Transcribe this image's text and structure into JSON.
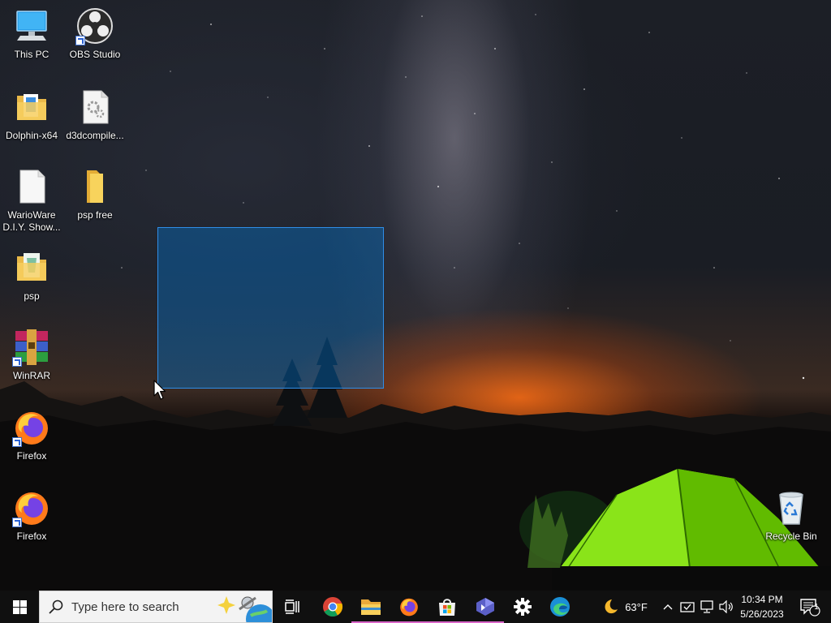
{
  "desktop": {
    "icons": [
      {
        "label": "This PC",
        "icon": "computer-icon"
      },
      {
        "label": "OBS Studio",
        "icon": "obs-studio-icon"
      },
      {
        "label": "Dolphin-x64",
        "icon": "folder-icon"
      },
      {
        "label": "d3dcompile...",
        "icon": "dll-file-icon"
      },
      {
        "label": "WarioWare D.I.Y. Show...",
        "icon": "blank-file-icon"
      },
      {
        "label": "psp free",
        "icon": "folder-icon"
      },
      {
        "label": "psp",
        "icon": "folder-icon"
      },
      {
        "label": "WinRAR",
        "icon": "winrar-icon"
      },
      {
        "label": "Firefox",
        "icon": "firefox-icon"
      },
      {
        "label": "Firefox",
        "icon": "firefox-icon"
      },
      {
        "label": "Recycle Bin",
        "icon": "recycle-bin-icon"
      }
    ]
  },
  "taskbar": {
    "search_placeholder": "Type here to search",
    "apps": [
      {
        "name": "Task View",
        "icon": "task-view-icon",
        "running": false
      },
      {
        "name": "Google Chrome",
        "icon": "chrome-icon",
        "running": false
      },
      {
        "name": "File Explorer",
        "icon": "file-explorer-icon",
        "running": true
      },
      {
        "name": "Firefox",
        "icon": "firefox-icon",
        "running": true
      },
      {
        "name": "Microsoft Store",
        "icon": "store-icon",
        "running": true
      },
      {
        "name": "Visual Studio",
        "icon": "visual-studio-icon",
        "running": true
      },
      {
        "name": "Settings",
        "icon": "gear-icon",
        "running": false
      },
      {
        "name": "Microsoft Edge",
        "icon": "edge-icon",
        "running": false
      }
    ],
    "weather": {
      "temperature": "63°F",
      "icon": "moon-icon"
    },
    "clock": {
      "time": "10:34 PM",
      "date": "5/26/2023"
    },
    "notification_count": "1"
  },
  "colors": {
    "taskbar_bg": "#101010",
    "selection_fill": "#0078d7",
    "running_indicator": "#d966c8",
    "start_blue": "#ffffff"
  }
}
